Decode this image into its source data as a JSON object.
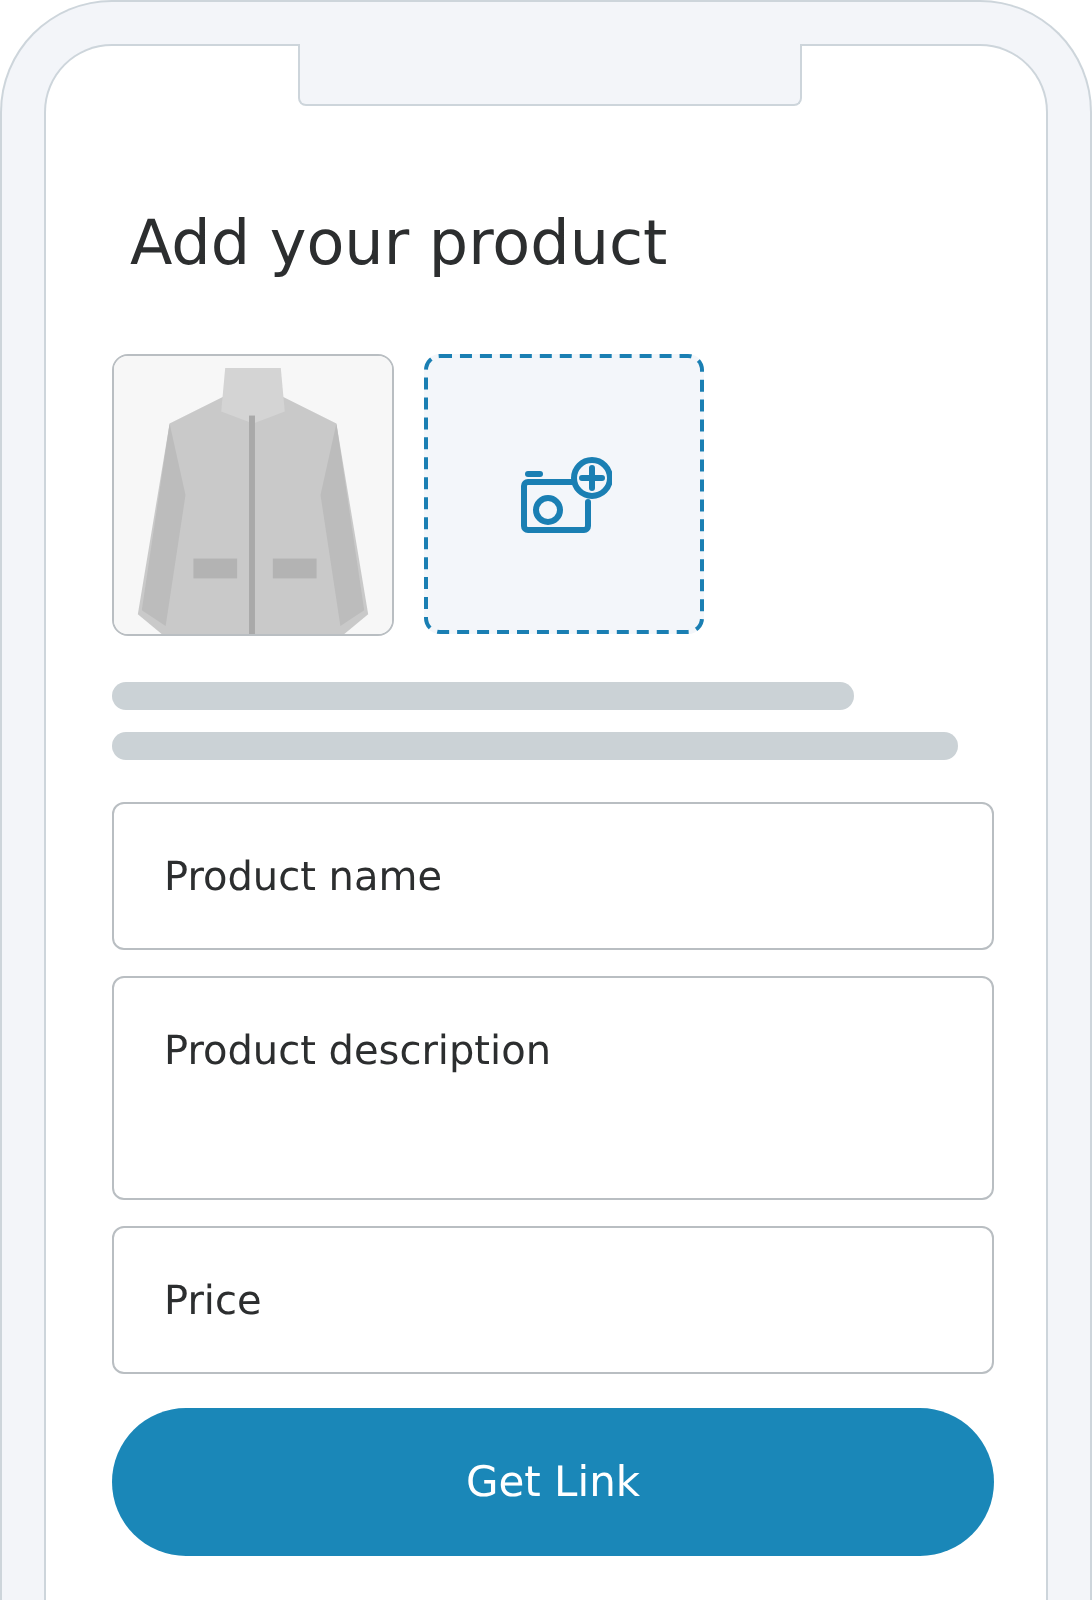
{
  "title": "Add your product",
  "fields": [
    {
      "kind": "single",
      "placeholder": "Product name"
    },
    {
      "kind": "multiline",
      "placeholder": "Product description"
    },
    {
      "kind": "single",
      "placeholder": "Price"
    }
  ],
  "button": {
    "label": "Get Link"
  }
}
